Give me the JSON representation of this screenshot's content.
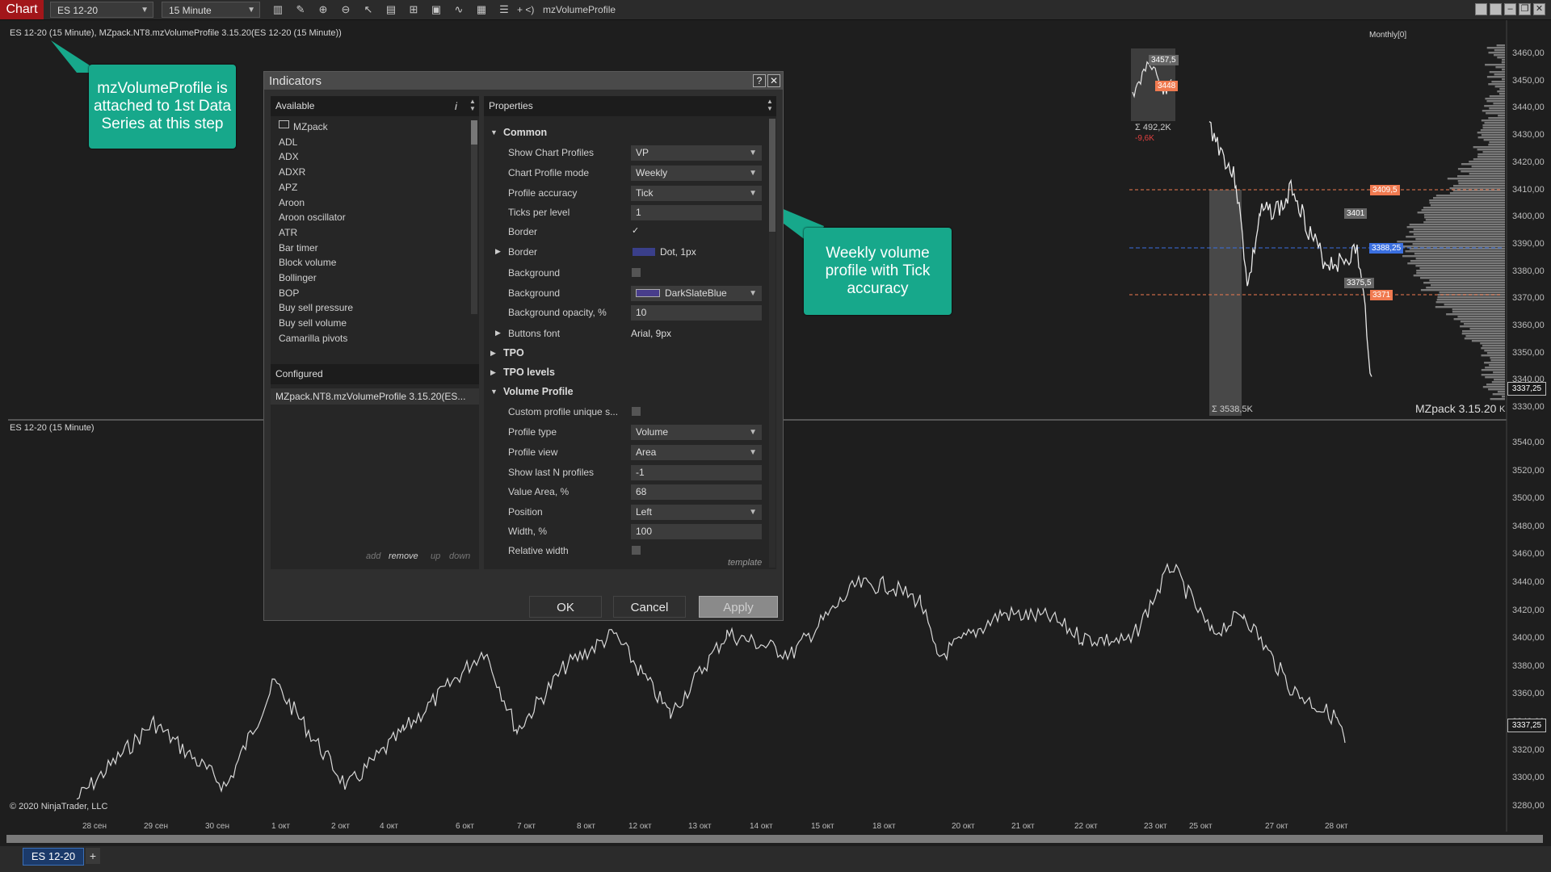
{
  "toolbar": {
    "chart_tab": "Chart",
    "instrument": "ES 12-20",
    "interval": "15 Minute",
    "extra": "+ <)",
    "template_name": "mzVolumeProfile",
    "icons": [
      "bar-type-icon",
      "drawing-tool-icon",
      "zoom-in-icon",
      "zoom-out-icon",
      "pointer-icon",
      "data-box-icon",
      "window-link-icon",
      "strategy-icon",
      "indicator-icon",
      "chart-trader-icon",
      "properties-icon"
    ]
  },
  "upper_panel": {
    "label": "ES 12-20 (15 Minute), MZpack.NT8.mzVolumeProfile 3.15.20(ES 12-20 (15 Minute))",
    "monthly": "Monthly[0]",
    "prices": [
      "3460,00",
      "3450,00",
      "3440,00",
      "3430,00",
      "3420,00",
      "3410,00",
      "3400,00",
      "3390,00",
      "3380,00",
      "3370,00",
      "3360,00",
      "3350,00",
      "3340,00",
      "3330,00"
    ],
    "current_price": "3337,25",
    "vp_labels": [
      "3457,5",
      "3448",
      "3409,5",
      "3401",
      "3388,25",
      "3375,5",
      "3371"
    ],
    "sum_small": "Σ 492,2K",
    "delta_small": "-9,6K",
    "sum_big": "Σ 3538,5K",
    "watermark": "MZpack 3.15.20",
    "watermark_tail": "K"
  },
  "lower_panel": {
    "label": "ES 12-20 (15 Minute)",
    "prices": [
      "3540,00",
      "3520,00",
      "3500,00",
      "3480,00",
      "3460,00",
      "3440,00",
      "3420,00",
      "3400,00",
      "3380,00",
      "3360,00",
      "3340,00",
      "3320,00",
      "3300,00",
      "3280,00"
    ],
    "current_price": "3337,25",
    "copyright": "© 2020 NinjaTrader, LLC"
  },
  "dates": [
    "28 сен",
    "29 сен",
    "30 сен",
    "1 окт",
    "2 окт",
    "4 окт",
    "6 окт",
    "7 окт",
    "8 окт",
    "12 окт",
    "13 окт",
    "14 окт",
    "15 окт",
    "18 окт",
    "20 окт",
    "21 окт",
    "22 окт",
    "23 окт",
    "25 окт",
    "27 окт",
    "28 окт"
  ],
  "callouts": {
    "left": "mzVolumeProfile is attached to 1st Data Series at this step",
    "right": "Weekly volume profile with Tick accuracy"
  },
  "dialog": {
    "title": "Indicators",
    "help": "?",
    "close": "✕",
    "available_header": "Available",
    "info_icon": "i",
    "available_items": [
      "MZpack",
      "ADL",
      "ADX",
      "ADXR",
      "APZ",
      "Aroon",
      "Aroon oscillator",
      "ATR",
      "Bar timer",
      "Block volume",
      "Bollinger",
      "BOP",
      "Buy sell pressure",
      "Buy sell volume",
      "Camarilla pivots"
    ],
    "configured_header": "Configured",
    "configured_items": [
      "MZpack.NT8.mzVolumeProfile 3.15.20(ES..."
    ],
    "actions": {
      "add": "add",
      "remove": "remove",
      "up": "up",
      "down": "down"
    },
    "properties_header": "Properties",
    "groups": {
      "common": "Common",
      "tpo": "TPO",
      "tpo_levels": "TPO levels",
      "volume_profile": "Volume Profile"
    },
    "props": {
      "show_chart_profiles": {
        "label": "Show Chart Profiles",
        "value": "VP"
      },
      "chart_profile_mode": {
        "label": "Chart Profile mode",
        "value": "Weekly"
      },
      "profile_accuracy": {
        "label": "Profile accuracy",
        "value": "Tick"
      },
      "ticks_per_level": {
        "label": "Ticks per level",
        "value": "1"
      },
      "border_check": {
        "label": "Border",
        "value": "✓"
      },
      "border": {
        "label": "Border",
        "value": "Dot, 1px"
      },
      "background_check": {
        "label": "Background"
      },
      "background": {
        "label": "Background",
        "value": "DarkSlateBlue"
      },
      "background_opacity": {
        "label": "Background opacity, %",
        "value": "10"
      },
      "buttons_font": {
        "label": "Buttons font",
        "value": "Arial, 9px"
      },
      "custom_profile": {
        "label": "Custom profile unique s..."
      },
      "profile_type": {
        "label": "Profile type",
        "value": "Volume"
      },
      "profile_view": {
        "label": "Profile view",
        "value": "Area"
      },
      "show_last_n": {
        "label": "Show last N profiles",
        "value": "-1"
      },
      "value_area": {
        "label": "Value Area, %",
        "value": "68"
      },
      "position": {
        "label": "Position",
        "value": "Left"
      },
      "width": {
        "label": "Width, %",
        "value": "100"
      },
      "relative_width": {
        "label": "Relative width"
      }
    },
    "template_link": "template",
    "ok": "OK",
    "cancel": "Cancel",
    "apply": "Apply"
  },
  "bottom": {
    "tab": "ES 12-20",
    "add": "+"
  },
  "colors": {
    "accent": "#17a88b",
    "chart_red": "#a2161a",
    "vp_orange": "#f07a50",
    "vp_blue": "#3a6fe0"
  }
}
